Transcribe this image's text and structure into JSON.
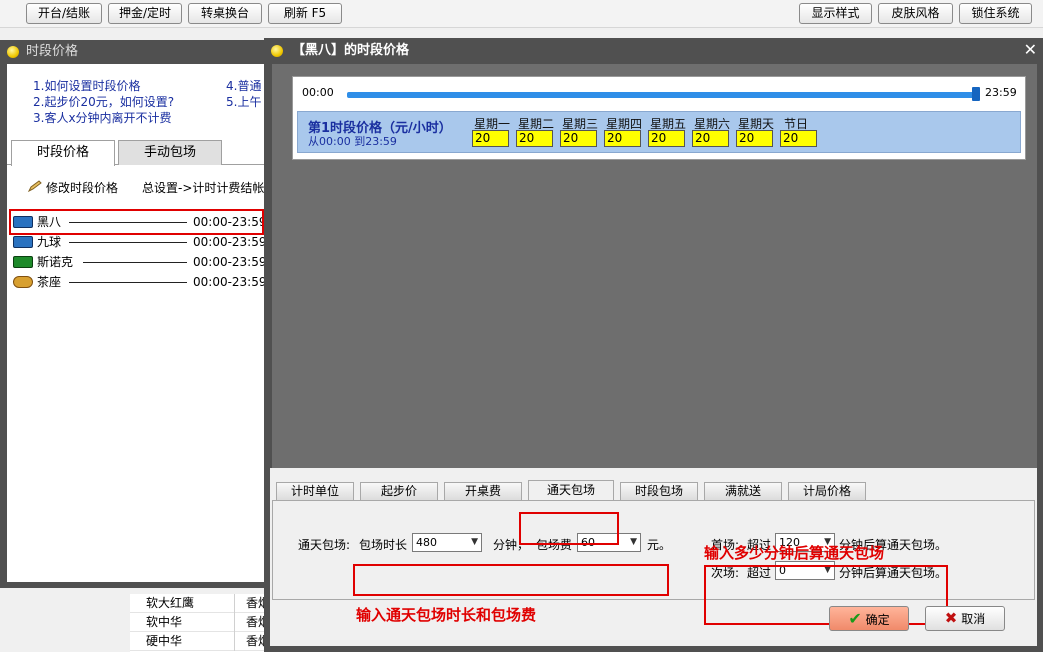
{
  "toolbar": {
    "left_buttons": [
      "开台/结账",
      "押金/定时",
      "转桌换台",
      "刷新 F5"
    ],
    "right_buttons": [
      "显示样式",
      "皮肤风格",
      "锁住系统"
    ]
  },
  "bg_list": [
    {
      "name": "软大红鹰",
      "type": "香烟"
    },
    {
      "name": "软中华",
      "type": "香烟"
    },
    {
      "name": "硬中华",
      "type": "香烟"
    }
  ],
  "left_window": {
    "title": "时段价格",
    "help": [
      "1.如何设置时段价格",
      "2.起步价20元，如何设置?",
      "3.客人x分钟内离开不计费",
      "4.普通",
      "5.上午"
    ],
    "tabs": [
      "时段价格",
      "手动包场"
    ],
    "edit_label": "修改时段价格",
    "settings_label": "总设置->计时计费结帐",
    "tables": [
      {
        "name": "黑八",
        "time": "00:00-23:59"
      },
      {
        "name": "九球",
        "time": "00:00-23:59"
      },
      {
        "name": "斯诺克",
        "time": "00:00-23:59"
      },
      {
        "name": "茶座",
        "time": "00:00-23:59"
      }
    ]
  },
  "dialog": {
    "title": "【黑八】的时段价格",
    "time_start": "00:00",
    "time_end": "23:59",
    "period_title": "第1时段价格（元/小时）",
    "period_range": "从00:00 到23:59",
    "days": [
      {
        "label": "星期一",
        "price": "20"
      },
      {
        "label": "星期二",
        "price": "20"
      },
      {
        "label": "星期三",
        "price": "20"
      },
      {
        "label": "星期四",
        "price": "20"
      },
      {
        "label": "星期五",
        "price": "20"
      },
      {
        "label": "星期六",
        "price": "20"
      },
      {
        "label": "星期天",
        "price": "20"
      },
      {
        "label": "节日",
        "price": "20"
      }
    ],
    "tabs": [
      "计时单位",
      "起步价",
      "开桌费",
      "通天包场",
      "时段包场",
      "满就送",
      "计局价格"
    ],
    "active_tab": "通天包场",
    "allday": {
      "label": "通天包场:",
      "duration_label": "包场时长",
      "duration_value": "480",
      "minute_unit": "分钟，",
      "fee_label": "包场费",
      "fee_value": "60",
      "yuan_unit": "元。"
    },
    "first": {
      "label": "首场:",
      "over": "超过",
      "value": "120",
      "suffix": "分钟后算通天包场。"
    },
    "second": {
      "label": "次场:",
      "over": "超过",
      "value": "0",
      "suffix": "分钟后算通天包场。"
    },
    "annotation_top": "输入多少分钟后算通天包场",
    "annotation_bottom": "输入通天包场时长和包场费",
    "ok_label": "确定",
    "cancel_label": "取消"
  }
}
